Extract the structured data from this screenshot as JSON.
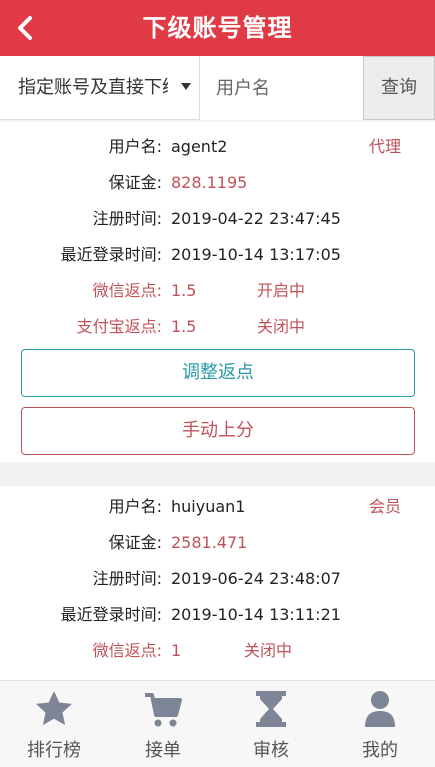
{
  "header": {
    "title": "下级账号管理"
  },
  "filter": {
    "select_value": "指定账号及直接下级",
    "input_placeholder": "用户名",
    "search_label": "查询"
  },
  "accounts": [
    {
      "username_label": "用户名:",
      "username": "agent2",
      "role": "代理",
      "deposit_label": "保证金:",
      "deposit": "828.1195",
      "reg_label": "注册时间:",
      "reg_time": "2019-04-22 23:47:45",
      "login_label": "最近登录时间:",
      "login_time": "2019-10-14 13:17:05",
      "wechat_label": "微信返点:",
      "wechat_rate": "1.5",
      "wechat_status": "开启中",
      "alipay_label": "支付宝返点:",
      "alipay_rate": "1.5",
      "alipay_status": "关闭中",
      "adjust_label": "调整返点",
      "manual_label": "手动上分"
    },
    {
      "username_label": "用户名:",
      "username": "huiyuan1",
      "role": "会员",
      "deposit_label": "保证金:",
      "deposit": "2581.471",
      "reg_label": "注册时间:",
      "reg_time": "2019-06-24 23:48:07",
      "login_label": "最近登录时间:",
      "login_time": "2019-10-14 13:11:21",
      "wechat_label": "微信返点:",
      "wechat_rate": "1",
      "wechat_status": "关闭中"
    }
  ],
  "tabbar": {
    "items": [
      {
        "label": "排行榜",
        "icon": "star-icon"
      },
      {
        "label": "接单",
        "icon": "cart-icon"
      },
      {
        "label": "审核",
        "icon": "hourglass-icon"
      },
      {
        "label": "我的",
        "icon": "user-icon"
      }
    ]
  },
  "colors": {
    "header_bg": "#e03a45",
    "accent_red": "#c0525a",
    "accent_teal": "#2a9aa6",
    "tab_icon": "#7d8596"
  }
}
